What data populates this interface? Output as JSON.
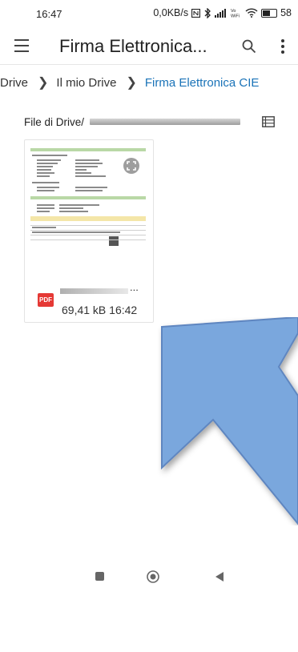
{
  "status_bar": {
    "time": "16:47",
    "speed": "0,0KB/s",
    "battery": "58",
    "icons": [
      "nfc-icon",
      "bluetooth-icon",
      "signal-icon",
      "vowifi-icon",
      "wifi-icon",
      "battery-icon"
    ]
  },
  "app_bar": {
    "title": "Firma Elettronica...",
    "icons": [
      "menu-icon",
      "search-icon",
      "more-vert-icon"
    ]
  },
  "breadcrumb": [
    "Drive",
    "Il mio Drive",
    "Firma Elettronica CIE"
  ],
  "section": {
    "title": "File di Drive/",
    "icon": "list-view-icon"
  },
  "file": {
    "type_badge": "PDF",
    "ellipsis": "...",
    "meta": "69,41 kB 16:42"
  },
  "colors": {
    "accent": "#1a73b8",
    "pdf_red": "#e53935",
    "arrow_fill": "#7aa7dd",
    "arrow_stroke": "#5f86c0"
  },
  "nav_bar": [
    "recents-button",
    "home-button",
    "back-button"
  ]
}
